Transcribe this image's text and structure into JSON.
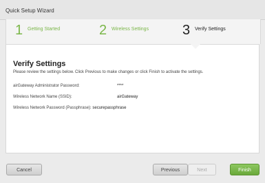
{
  "window": {
    "title": "Quick Setup Wizard"
  },
  "steps": [
    {
      "number": "1",
      "label": "Getting Started",
      "state": "done"
    },
    {
      "number": "2",
      "label": "Wireless Settings",
      "state": "done"
    },
    {
      "number": "3",
      "label": "Verify Settings",
      "state": "active"
    }
  ],
  "content": {
    "heading": "Verify Settings",
    "intro": "Please review the settings below. Click Previous to make changes or click Finish to activate the settings.",
    "settings": [
      {
        "label": "airGateway Administrator Password:",
        "value": "****"
      },
      {
        "label": "Wireless Network Name (SSID):",
        "value": "airGateway"
      },
      {
        "label": "Wireless Network Password (Passphrase):",
        "value": "securepassphrase"
      }
    ]
  },
  "buttons": {
    "cancel": "Cancel",
    "previous": "Previous",
    "next": "Next",
    "finish": "Finish"
  },
  "colors": {
    "accent": "#7ab648",
    "finish_button": "#6aa83a"
  }
}
